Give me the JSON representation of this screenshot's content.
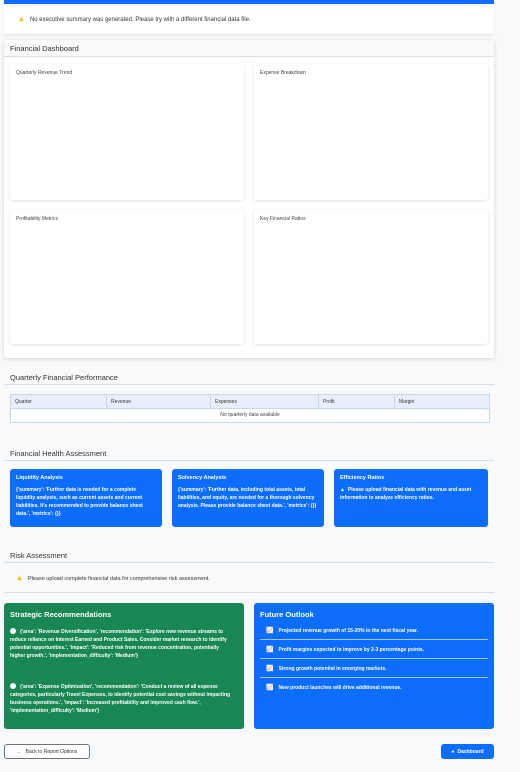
{
  "alert": {
    "message": "No executive summary was generated. Please try with a different financial data file."
  },
  "dashboard": {
    "title": "Financial Dashboard",
    "panels": {
      "revenue": "Quarterly Revenue Trend",
      "expense": "Expense Breakdown",
      "profit": "Profitability Metrics",
      "ratios": "Key Financial Ratios"
    }
  },
  "quarterly": {
    "title": "Quarterly Financial Performance",
    "columns": [
      "Quarter",
      "Revenue",
      "Expenses",
      "Profit",
      "Margin"
    ],
    "empty": "No quarterly data available"
  },
  "health": {
    "title": "Financial Health Assessment",
    "liquidity": {
      "title": "Liquidity Analysis",
      "body": "{'summary': 'Further data is needed for a complete liquidity analysis, such as current assets and current liabilities. It's recommended to provide balance sheet data.', 'metrics': {}}"
    },
    "solvency": {
      "title": "Solvency Analysis",
      "body": "{'summary': 'Further data, including total assets, total liabilities, and equity, are needed for a thorough solvency analysis. Please provide balance sheet data.', 'metrics': {}}"
    },
    "efficiency": {
      "title": "Efficiency Ratios",
      "body": "Please upload financial data with revenue and asset information to analyze efficiency ratios."
    }
  },
  "risk": {
    "title": "Risk Assessment",
    "message": "Please upload complete financial data for comprehensive risk assessment."
  },
  "strategic": {
    "title": "Strategic Recommendations",
    "items": [
      "{'area': 'Revenue Diversification', 'recommendation': 'Explore new revenue streams to reduce reliance on Interest Earned and Product Sales. Consider market research to identify potential opportunities.', 'impact': 'Reduced risk from revenue concentration, potentially higher growth.', 'implementation_difficulty': 'Medium'}",
      "{'area': 'Expense Optimization', 'recommendation': 'Conduct a review of all expense categories, particularly Travel Expenses, to identify potential cost savings without impacting business operations.', 'impact': 'Increased profitability and improved cash flow.', 'implementation_difficulty': 'Medium'}"
    ]
  },
  "outlook": {
    "title": "Future Outlook",
    "items": [
      "Projected revenue growth of 15-20% in the next fiscal year.",
      "Profit margins expected to improve by 2-3 percentage points.",
      "Strong growth potential in emerging markets.",
      "New product launches will drive additional revenue."
    ]
  },
  "buttons": {
    "back": "Back to Report Options",
    "dashboard": "Dashboard"
  }
}
